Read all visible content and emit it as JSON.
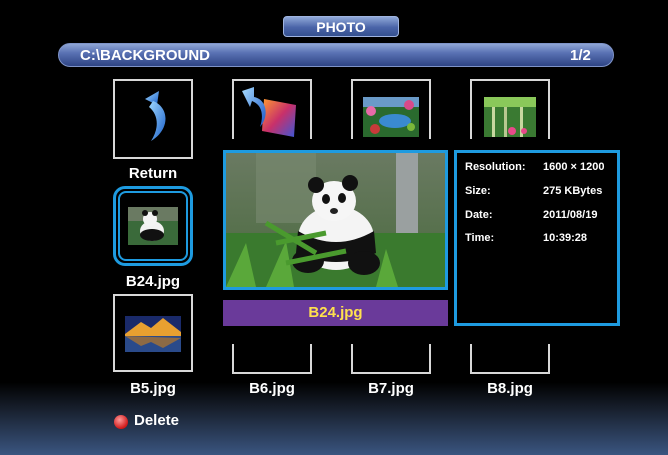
{
  "header": {
    "title": "PHOTO"
  },
  "path_bar": {
    "path": "C:\\BACKGROUND",
    "page": "1/2"
  },
  "thumbnails": [
    {
      "label": "Return",
      "icon": "return-arrow-icon"
    },
    {
      "label": "",
      "icon": "folder-icon"
    },
    {
      "label": "",
      "icon": "garden-thumbnail"
    },
    {
      "label": "",
      "icon": "forest-thumbnail"
    },
    {
      "label": "B24.jpg",
      "icon": "panda-thumbnail"
    },
    {
      "label": "B5.jpg",
      "icon": "mountain-lake-thumbnail"
    },
    {
      "label": "B6.jpg"
    },
    {
      "label": "B7.jpg"
    },
    {
      "label": "B8.jpg"
    }
  ],
  "preview": {
    "caption": "B24.jpg",
    "image": "panda-photo"
  },
  "info": {
    "resolution_label": "Resolution:",
    "resolution_value": "1600 × 1200",
    "size_label": "Size:",
    "size_value": "275 KBytes",
    "date_label": "Date:",
    "date_value": "2011/08/19",
    "time_label": "Time:",
    "time_value": "10:39:28"
  },
  "footer": {
    "delete_label": "Delete"
  },
  "colors": {
    "accent": "#1e9be0",
    "caption_bg": "#6a3a9a",
    "caption_text": "#ffe14d",
    "delete_button": "#d01818"
  }
}
